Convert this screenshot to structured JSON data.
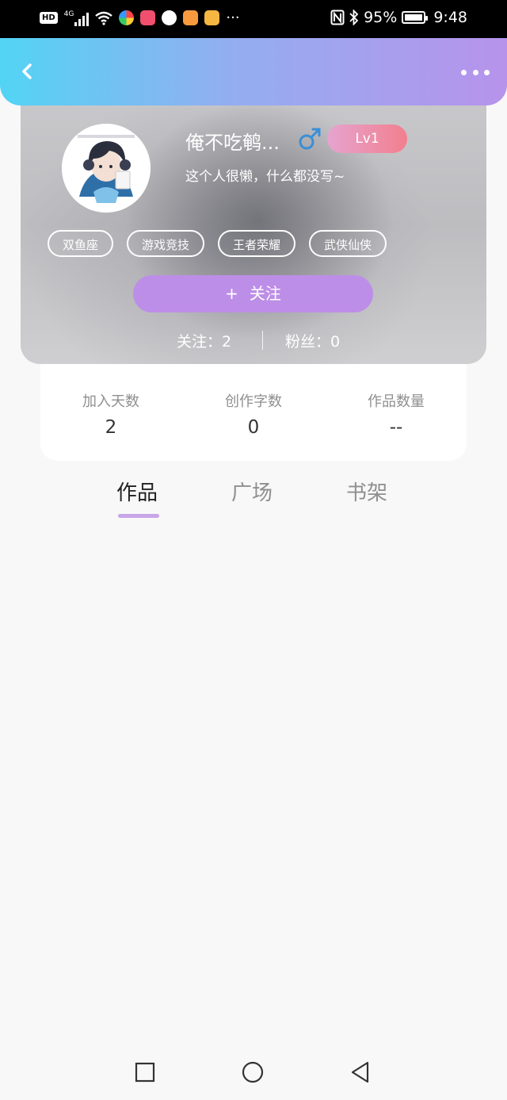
{
  "status_bar": {
    "network": "4G",
    "battery": "95%",
    "time": "9:48",
    "dots": "···",
    "icons": [
      "hd-icon",
      "signal-icon",
      "wifi-icon",
      "app-icon",
      "app-icon",
      "app-icon",
      "app-icon",
      "app-icon",
      "nfc-icon",
      "bluetooth-icon",
      "battery-icon"
    ]
  },
  "header": {
    "back_icon": "chevron-left-icon",
    "more_icon": "more-dots-icon"
  },
  "profile": {
    "nickname": "俺不吃鹌...",
    "gender_icon": "male-icon",
    "gender_color": "#3a8fd6",
    "level": "Lv1",
    "bio": "这个人很懒，什么都没写~",
    "tags": [
      "双鱼座",
      "游戏竞技",
      "王者荣耀",
      "武侠仙侠"
    ],
    "follow_label": "关注",
    "follow_plus": "+",
    "following": "关注：2",
    "fans": "粉丝：0"
  },
  "stats": [
    {
      "label": "加入天数",
      "value": "2"
    },
    {
      "label": "创作字数",
      "value": "0"
    },
    {
      "label": "作品数量",
      "value": "--"
    }
  ],
  "tabs": [
    {
      "label": "作品",
      "active": true
    },
    {
      "label": "广场",
      "active": false
    },
    {
      "label": "书架",
      "active": false
    }
  ],
  "colors": {
    "accent": "#bd8ee7",
    "header_gradient_start": "#52d4f4",
    "header_gradient_end": "#b793ec",
    "tab_indicator": "#c8a6e8"
  },
  "nav_bar": {
    "icons": [
      "recent-apps-icon",
      "home-icon",
      "back-triangle-icon"
    ]
  }
}
